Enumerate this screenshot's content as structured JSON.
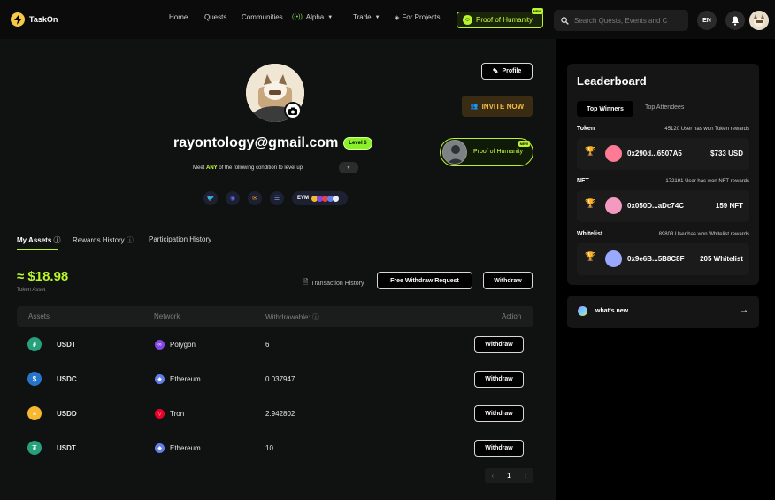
{
  "nav": {
    "brand": "TaskOn",
    "links": [
      "Home",
      "Quests",
      "Communities",
      "Alpha",
      "Trade",
      "For Projects"
    ],
    "proof_of_humanity": "Proof of Humanity",
    "new_badge": "NEW",
    "search_placeholder": "Search Quests, Events and C",
    "lang": "EN",
    "icons": {
      "brand": "bolt-icon",
      "alpha": "signal-icon",
      "projects": "layers-icon",
      "search": "search-icon",
      "bell": "bell-icon"
    }
  },
  "profile": {
    "profile_button": "Profile",
    "invite_button": "INVITE NOW",
    "email": "rayontology@gmail.com",
    "level": "Level 6",
    "condition_prefix": "Meet ",
    "condition_any": "ANY",
    "condition_suffix": " of the following condition to level up",
    "evm_label": "EVM",
    "poh_card": "Proof of Humanity",
    "poh_badge": "NEW",
    "socials": [
      "twitter-icon",
      "discord-icon",
      "email-icon",
      "wallet-icon"
    ]
  },
  "tabs": [
    "My Assets",
    "Rewards History",
    "Participation History"
  ],
  "assets": {
    "total": "≈ $18.98",
    "total_label": "Token Asset",
    "transaction_history": "Transaction History",
    "free_withdraw": "Free Withdraw Request",
    "withdraw": "Withdraw",
    "columns": [
      "Assets",
      "Network",
      "Withdrawable:",
      "Action"
    ],
    "rows": [
      {
        "asset": "USDT",
        "network": "Polygon",
        "amount": "6",
        "action": "Withdraw",
        "coin_color": "#26a17b",
        "net_color": "#8247e5",
        "coin_glyph": "₮",
        "net_glyph": "∞"
      },
      {
        "asset": "USDC",
        "network": "Ethereum",
        "amount": "0.037947",
        "action": "Withdraw",
        "coin_color": "#2775ca",
        "net_color": "#627eea",
        "coin_glyph": "$",
        "net_glyph": "◆"
      },
      {
        "asset": "USDD",
        "network": "Tron",
        "amount": "2.942802",
        "action": "Withdraw",
        "coin_color": "#f5b82e",
        "net_color": "#eb0029",
        "coin_glyph": "≡",
        "net_glyph": "▽"
      },
      {
        "asset": "USDT",
        "network": "Ethereum",
        "amount": "10",
        "action": "Withdraw",
        "coin_color": "#26a17b",
        "net_color": "#627eea",
        "coin_glyph": "₮",
        "net_glyph": "◆"
      }
    ],
    "pagination": {
      "prev": "‹",
      "page": "1",
      "next": "›"
    }
  },
  "leaderboard": {
    "title": "Leaderboard",
    "tab_active": "Top Winners",
    "tab_other": "Top Attendees",
    "sections": [
      {
        "label": "Token",
        "note": "45120 User has won Token rewards",
        "address": "0x290d...6507A5",
        "reward": "$733 USD",
        "avatar_color": "#ff7a94"
      },
      {
        "label": "NFT",
        "note": "172191 User has won NFT rewards",
        "address": "0x050D...aDc74C",
        "reward": "159 NFT",
        "avatar_color": "#f49ac1"
      },
      {
        "label": "Whitelist",
        "note": "89803 User has won Whitelist rewards",
        "address": "0x9e6B...5B8C8F",
        "reward": "205 Whitelist",
        "avatar_color": "#9aa8ff"
      }
    ]
  },
  "whats_new": "what's new"
}
